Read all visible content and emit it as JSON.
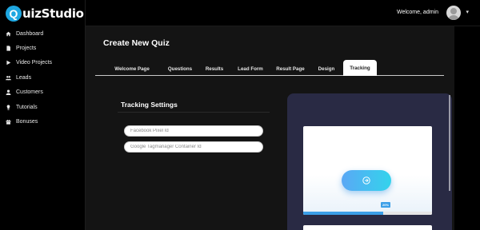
{
  "app": {
    "logo_letter": "Q",
    "logo_text": "uizStudio"
  },
  "sidebar": {
    "items": [
      {
        "label": "Dashboard",
        "icon": "home-icon"
      },
      {
        "label": "Projects",
        "icon": "file-icon"
      },
      {
        "label": "Video Projects",
        "icon": "play-icon"
      },
      {
        "label": "Leads",
        "icon": "users-icon"
      },
      {
        "label": "Customers",
        "icon": "user-icon"
      },
      {
        "label": "Tutorials",
        "icon": "bulb-icon"
      },
      {
        "label": "Bonuses",
        "icon": "gift-icon"
      }
    ]
  },
  "header": {
    "welcome": "Welcome, admin",
    "caret": "▾"
  },
  "main": {
    "title": "Create New Quiz",
    "tabs": [
      {
        "label": "Welcome Page",
        "active": false
      },
      {
        "label": "Questions",
        "active": false
      },
      {
        "label": "Results",
        "active": false
      },
      {
        "label": "Lead Form",
        "active": false
      },
      {
        "label": "Result Page",
        "active": false
      },
      {
        "label": "Design",
        "active": false
      },
      {
        "label": "Tracking",
        "active": true
      }
    ]
  },
  "tracking": {
    "title": "Tracking Settings",
    "facebook_placeholder": "Facebook Pixel Id",
    "facebook_value": "",
    "gtm_placeholder": "Google Tagmanager Container Id",
    "gtm_value": ""
  },
  "preview": {
    "progress_label": "20%",
    "progress_fraction": 0.62
  },
  "colors": {
    "accent": "#1ea7e1",
    "preview_bg": "#292a44",
    "button_start": "#5aa8f5",
    "button_end": "#33d3ec",
    "progress": "#3b9fe8"
  }
}
